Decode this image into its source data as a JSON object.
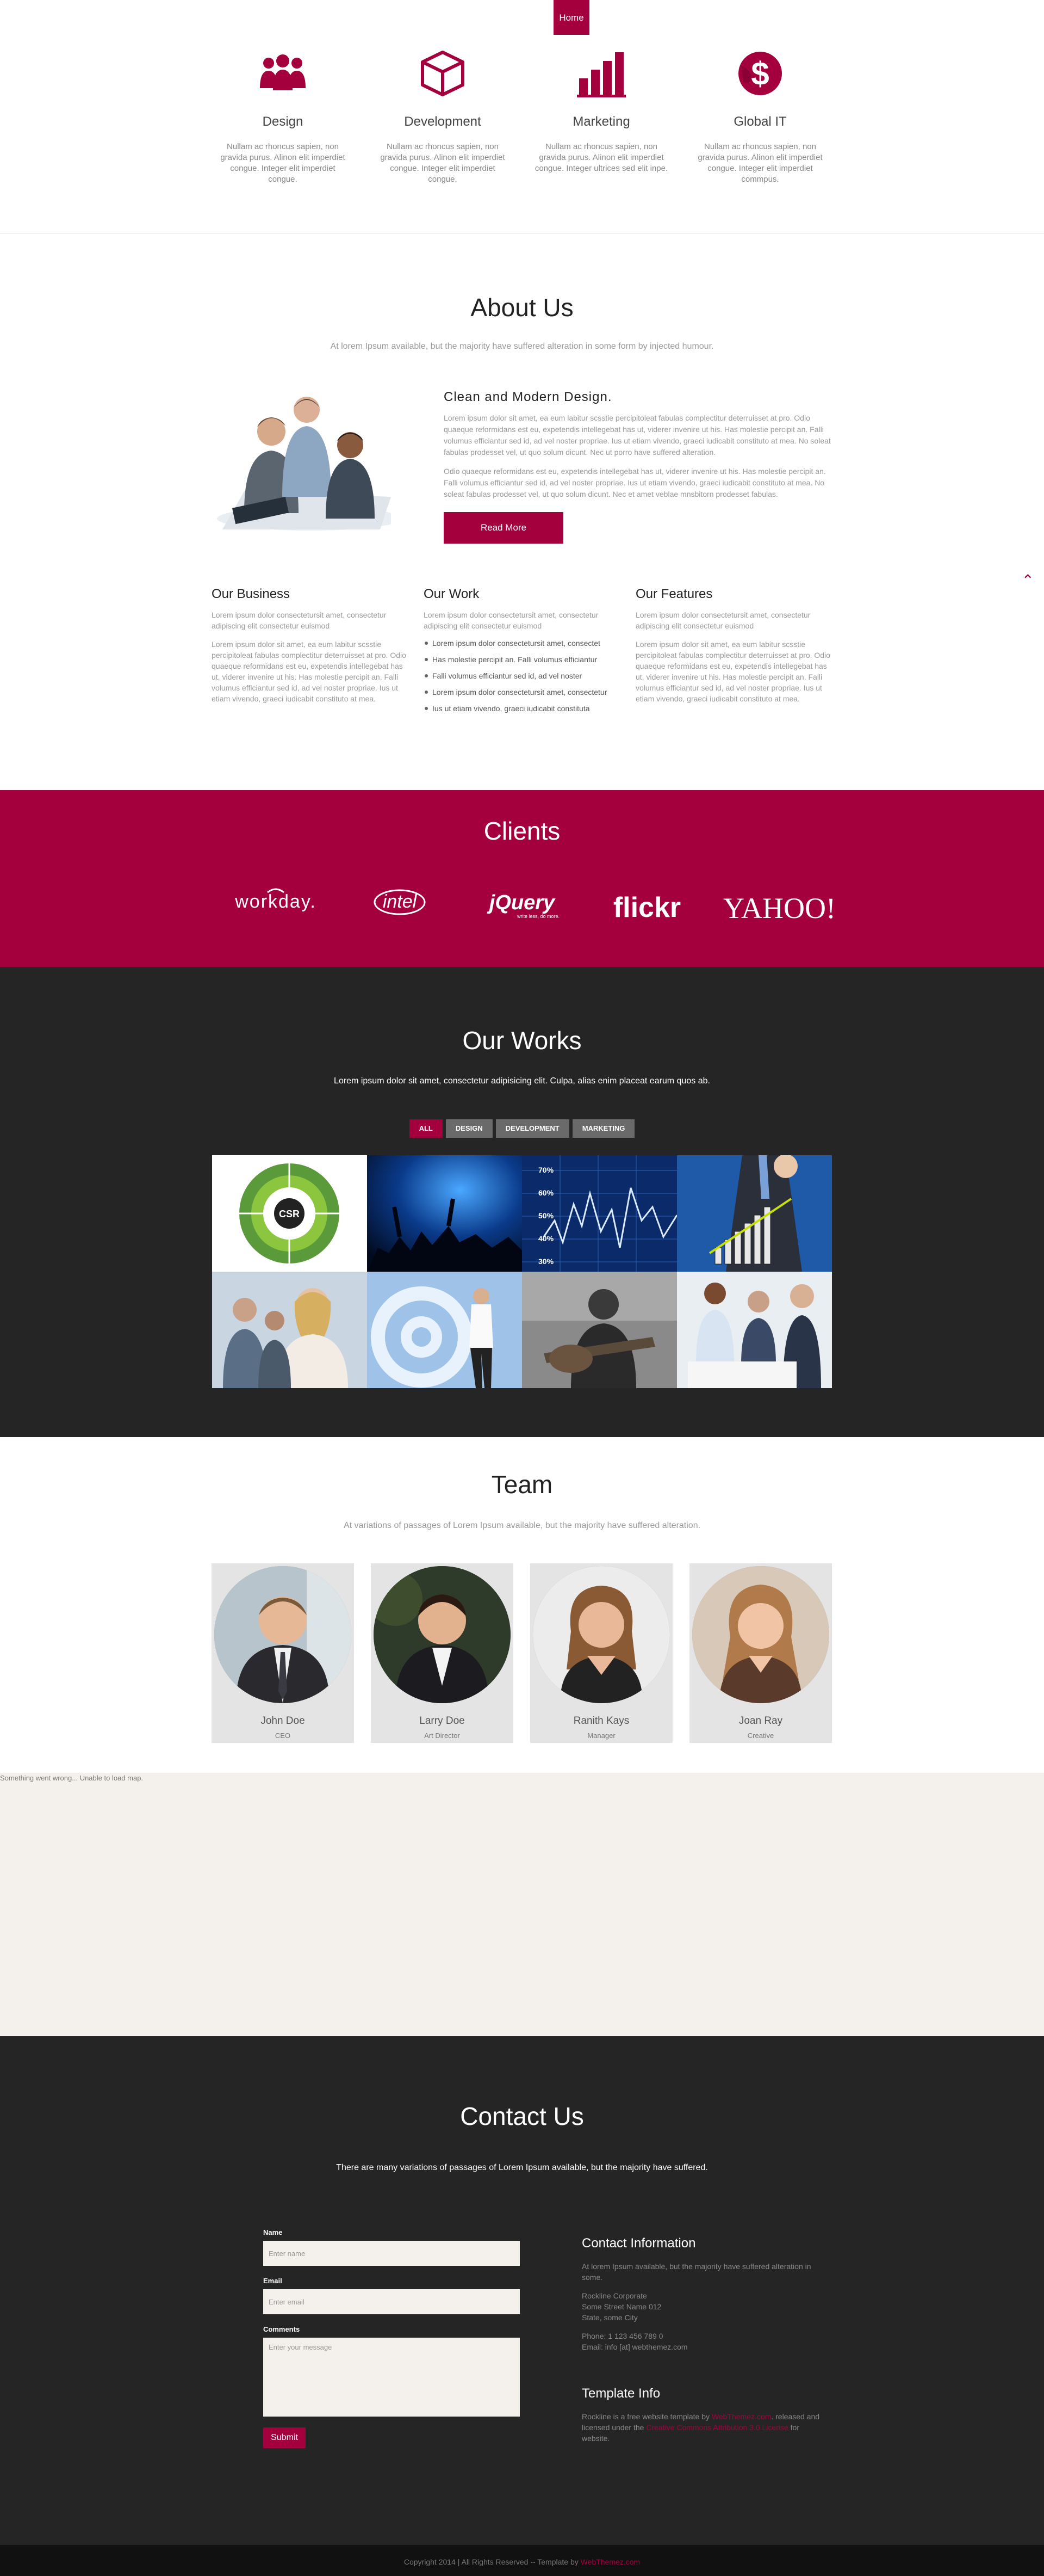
{
  "nav": {
    "home": "Home"
  },
  "features": [
    {
      "title": "Design",
      "text": "Nullam ac rhoncus sapien, non gravida purus. Alinon elit imperdiet congue. Integer elit imperdiet congue."
    },
    {
      "title": "Development",
      "text": "Nullam ac rhoncus sapien, non gravida purus. Alinon elit imperdiet congue. Integer elit imperdiet congue."
    },
    {
      "title": "Marketing",
      "text": "Nullam ac rhoncus sapien, non gravida purus. Alinon elit imperdiet congue. Integer ultrices sed elit inpe."
    },
    {
      "title": "Global IT",
      "text": "Nullam ac rhoncus sapien, non gravida purus. Alinon elit imperdiet congue. Integer elit imperdiet commpus."
    }
  ],
  "about": {
    "title": "About Us",
    "subtitle": "At lorem Ipsum available, but the majority have suffered alteration in some form by injected humour.",
    "heading": "Clean and Modern Design.",
    "para1": "Lorem ipsum dolor sit amet, ea eum labitur scsstie percipitoleat fabulas complectitur deterruisset at pro. Odio quaeque reformidans est eu, expetendis intellegebat has ut, viderer invenire ut his. Has molestie percipit an. Falli volumus efficiantur sed id, ad vel noster propriae. Ius ut etiam vivendo, graeci iudicabit constituto at mea. No soleat fabulas prodesset vel, ut quo solum dicunt. Nec ut porro have suffered alteration.",
    "para2": "Odio quaeque reformidans est eu, expetendis intellegebat has ut, viderer invenire ut his. Has molestie percipit an. Falli volumus efficiantur sed id, ad vel noster propriae. Ius ut etiam vivendo, graeci iudicabit constituto at mea. No soleat fabulas prodesset vel, ut quo solum dicunt. Nec et amet veblae mnsbitorn prodesset fabulas.",
    "button": "Read More",
    "columns": [
      {
        "title": "Our Business",
        "intro": "Lorem ipsum dolor consectetursit amet, consectetur adipiscing elit consectetur euismod",
        "body": "Lorem ipsum dolor sit amet, ea eum labitur scsstie percipitoleat fabulas complectitur deterruisset at pro. Odio quaeque reformidans est eu, expetendis intellegebat has ut, viderer invenire ut his. Has molestie percipit an. Falli volumus efficiantur sed id, ad vel noster propriae. Ius ut etiam vivendo, graeci iudicabit constituto at mea."
      },
      {
        "title": "Our Work",
        "intro": "Lorem ipsum dolor consectetursit amet, consectetur adipiscing elit consectetur euismod",
        "items": [
          "Lorem ipsum dolor consectetursit amet, consectet",
          "Has molestie percipit an. Falli volumus efficiantur",
          "Falli volumus efficiantur sed id, ad vel noster",
          "Lorem ipsum dolor consectetursit amet, consectetur",
          "Ius ut etiam vivendo, graeci iudicabit constituta"
        ]
      },
      {
        "title": "Our Features",
        "intro": "Lorem ipsum dolor consectetursit amet, consectetur adipiscing elit consectetur euismod",
        "body": "Lorem ipsum dolor sit amet, ea eum labitur scsstie percipitoleat fabulas complectitur deterruisset at pro. Odio quaeque reformidans est eu, expetendis intellegebat has ut, viderer invenire ut his. Has molestie percipit an. Falli volumus efficiantur sed id, ad vel noster propriae. Ius ut etiam vivendo, graeci iudicabit constituto at mea."
      }
    ]
  },
  "clients": {
    "title": "Clients",
    "logos": [
      "workday.",
      "intel",
      "jQuery",
      "flickr",
      "YAHOO!"
    ],
    "jquery_tagline": "write less, do more."
  },
  "works": {
    "title": "Our Works",
    "subtitle": "Lorem ipsum dolor sit amet, consectetur adipisicing elit. Culpa, alias enim placeat earum quos ab.",
    "filters": [
      "ALL",
      "DESIGN",
      "DEVELOPMENT",
      "MARKETING"
    ],
    "csr_label": "CSR",
    "chart_ticks": [
      "70%",
      "60%",
      "50%",
      "40%",
      "30%"
    ]
  },
  "team": {
    "title": "Team",
    "subtitle": "At variations of passages of Lorem Ipsum available, but the majority have suffered alteration.",
    "members": [
      {
        "name": "John Doe",
        "role": "CEO"
      },
      {
        "name": "Larry Doe",
        "role": "Art Director"
      },
      {
        "name": "Ranith Kays",
        "role": "Manager"
      },
      {
        "name": "Joan Ray",
        "role": "Creative"
      }
    ]
  },
  "map": {
    "error": "Something went wrong... Unable to load map."
  },
  "contact": {
    "title": "Contact Us",
    "subtitle": "There are many variations of passages of Lorem Ipsum available, but the majority have suffered.",
    "form": {
      "name_label": "Name",
      "name_placeholder": "Enter name",
      "email_label": "Email",
      "email_placeholder": "Enter email",
      "comments_label": "Comments",
      "comments_placeholder": "Enter your message",
      "submit": "Submit"
    },
    "info": {
      "title": "Contact Information",
      "text": "At lorem Ipsum available, but the majority have suffered alteration in some.",
      "address1": "Rockline Corporate",
      "address2": "Some Street Name 012",
      "address3": "State, some City",
      "phone": "Phone: 1 123 456 789 0",
      "email": "Email: info [at] webthemez.com"
    },
    "template": {
      "title": "Template Info",
      "pre": "Rockline is a free website template by ",
      "link1": "WebThemez.com",
      "mid": ". released and licensed under the ",
      "link2": "Creative Commons Attribution 3.0 License",
      "post": " for website."
    }
  },
  "footer": {
    "text": "Copyright 2014 | All Rights Reserved -- Template by ",
    "link": "WebThemez.com"
  },
  "colors": {
    "accent": "#a4003e",
    "dark": "#252525",
    "footer": "#111111",
    "map_bg": "#f4f1ec"
  }
}
